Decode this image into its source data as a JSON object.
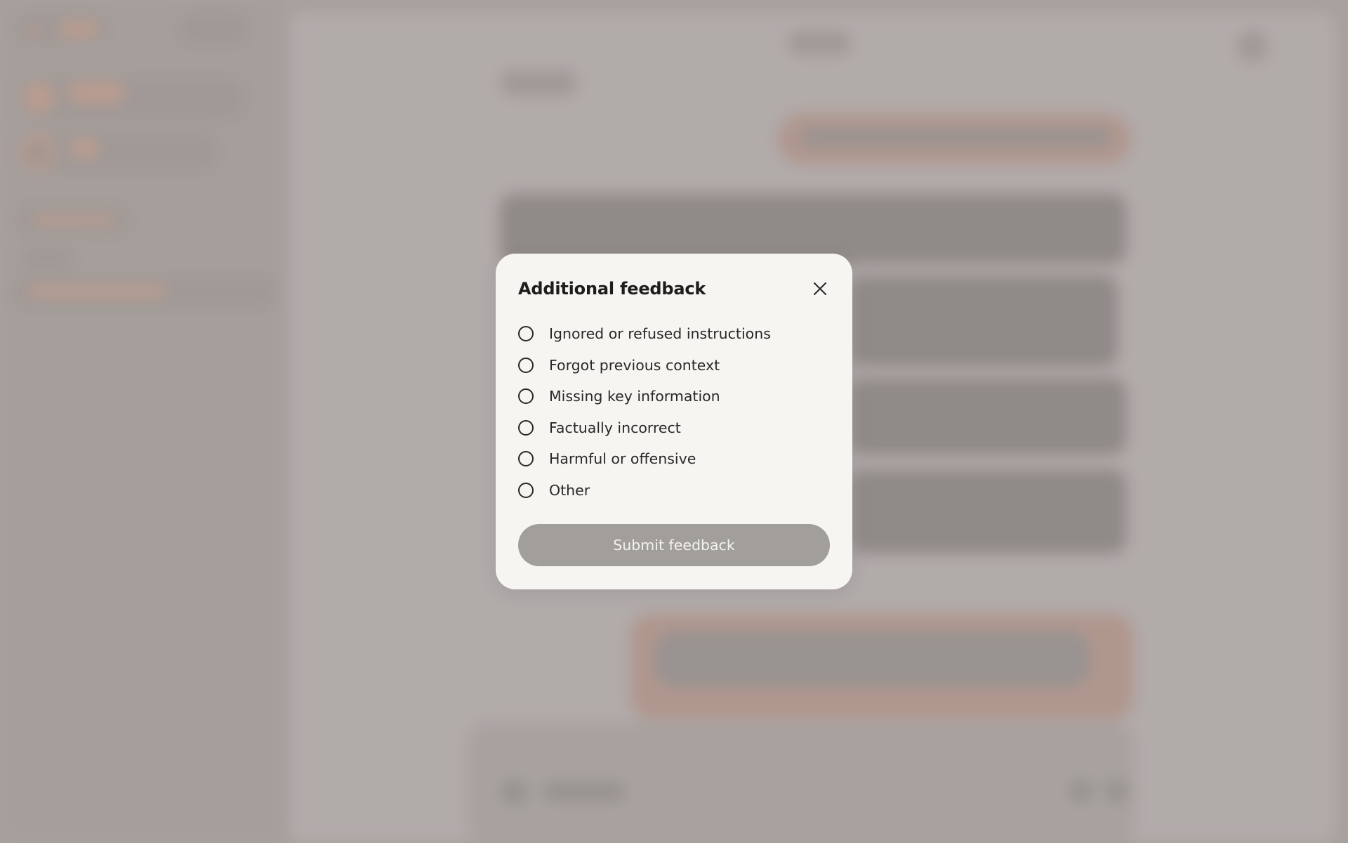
{
  "modal": {
    "title": "Additional feedback",
    "options": [
      {
        "label": "Ignored or refused instructions"
      },
      {
        "label": "Forgot previous context"
      },
      {
        "label": "Missing key information"
      },
      {
        "label": "Factually incorrect"
      },
      {
        "label": "Harmful or offensive"
      },
      {
        "label": "Other"
      }
    ],
    "submit_label": "Submit feedback",
    "icons": {
      "close": "close-icon"
    }
  },
  "colors": {
    "modal_background": "#f7f5f2",
    "submit_button_disabled": "#a29e9b",
    "text": "#2a2826"
  }
}
